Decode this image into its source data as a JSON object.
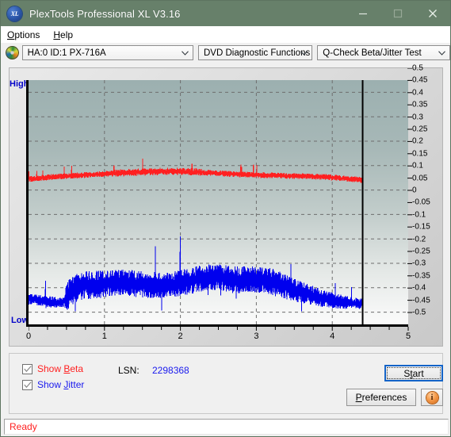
{
  "window": {
    "title": "PlexTools Professional XL V3.16",
    "app_icon": "xl-badge-icon",
    "badge_text": "XL",
    "minimize": "minimize-icon",
    "maximize": "maximize-icon",
    "close": "close-icon",
    "titlebar_color": "#67806a"
  },
  "menu": {
    "items": [
      {
        "label": "Options",
        "accel": "O"
      },
      {
        "label": "Help",
        "accel": "H"
      }
    ]
  },
  "toolbar": {
    "drive_icon": "cd-disc-icon",
    "drive": {
      "value": "HA:0 ID:1  PX-716A"
    },
    "function": {
      "value": "DVD Diagnostic Functions"
    },
    "test": {
      "value": "Q-Check Beta/Jitter Test"
    }
  },
  "chart_labels": {
    "high": "High",
    "low": "Low"
  },
  "controls": {
    "show_beta": {
      "label_pre": "Show ",
      "accel": "B",
      "label_post": "eta",
      "checked": true,
      "color": "#ff2020"
    },
    "show_jitter": {
      "label_pre": "Show ",
      "accel": "J",
      "label_post": "itter",
      "checked": true,
      "color": "#1a1aee"
    },
    "lsn_label": "LSN:",
    "lsn_value": "2298368",
    "start": {
      "label_pre": "S",
      "accel": "t",
      "label_post": "art",
      "focused": true
    },
    "preferences": {
      "label_pre": "P",
      "accel": "",
      "label_post": "references"
    },
    "info_icon": "info-icon",
    "info_glyph": "i"
  },
  "status": {
    "text": "Ready",
    "color": "#ff2020"
  },
  "chart_data": {
    "type": "line",
    "title": "Q-Check Beta/Jitter Test",
    "xlabel": "",
    "ylabel": "",
    "xlim": [
      0,
      5
    ],
    "ylim": [
      -0.5,
      0.5
    ],
    "grid": true,
    "legend_position": "bottom-left",
    "x_ticks": [
      0,
      1,
      2,
      3,
      4,
      5
    ],
    "x_tick_labels": [
      "0",
      "1",
      "2",
      "3",
      "4",
      "5"
    ],
    "x_minor_ticks_per_major": 4,
    "y_ticks": [
      0.5,
      0.45,
      0.4,
      0.35,
      0.3,
      0.25,
      0.2,
      0.15,
      0.1,
      0.05,
      0,
      -0.05,
      -0.1,
      -0.15,
      -0.2,
      -0.25,
      -0.3,
      -0.35,
      -0.4,
      -0.45,
      -0.5
    ],
    "y_tick_labels": [
      "0.5",
      "0.45",
      "0.4",
      "0.35",
      "0.3",
      "0.25",
      "0.2",
      "0.15",
      "0.1",
      "0.05",
      "0",
      "-0.05",
      "-0.1",
      "-0.15",
      "-0.2",
      "-0.25",
      "-0.3",
      "-0.35",
      "-0.4",
      "-0.45",
      "-0.5"
    ],
    "gridline_y_values": [
      0.45,
      0.35,
      0.25,
      0.15,
      0.05,
      -0.05,
      -0.15,
      -0.25,
      -0.35,
      -0.45
    ],
    "cursor_line_x": 4.4,
    "data_end_x": 4.4,
    "plot_bg_gradient": [
      "#9cb0b0",
      "#fbfbfb"
    ],
    "series": [
      {
        "name": "Beta",
        "color": "#ff2020",
        "x": [
          0.0,
          0.11,
          0.22,
          0.33,
          0.44,
          0.55,
          0.66,
          0.77,
          0.88,
          0.99,
          1.1,
          1.21,
          1.32,
          1.43,
          1.54,
          1.65,
          1.76,
          1.87,
          1.98,
          2.09,
          2.2,
          2.31,
          2.42,
          2.53,
          2.64,
          2.75,
          2.86,
          2.97,
          3.08,
          3.19,
          3.3,
          3.41,
          3.52,
          3.63,
          3.74,
          3.85,
          3.96,
          4.07,
          4.18,
          4.29,
          4.4
        ],
        "values": [
          0.095,
          0.098,
          0.101,
          0.104,
          0.106,
          0.108,
          0.11,
          0.112,
          0.114,
          0.116,
          0.118,
          0.12,
          0.122,
          0.123,
          0.124,
          0.125,
          0.126,
          0.126,
          0.126,
          0.125,
          0.124,
          0.122,
          0.12,
          0.118,
          0.116,
          0.114,
          0.113,
          0.112,
          0.111,
          0.11,
          0.109,
          0.108,
          0.107,
          0.106,
          0.105,
          0.104,
          0.102,
          0.1,
          0.097,
          0.094,
          0.09
        ],
        "noise_band": 0.012,
        "description": "Beta value, fairly flat between 0.09 and 0.13, peaking near x=1.8 and sloping down toward the end"
      },
      {
        "name": "Jitter",
        "color": "#0000ee",
        "x": [
          0.0,
          0.11,
          0.22,
          0.33,
          0.44,
          0.55,
          0.66,
          0.77,
          0.88,
          0.99,
          1.1,
          1.21,
          1.32,
          1.43,
          1.54,
          1.65,
          1.76,
          1.87,
          1.98,
          2.09,
          2.2,
          2.31,
          2.42,
          2.53,
          2.64,
          2.75,
          2.86,
          2.97,
          3.08,
          3.19,
          3.3,
          3.41,
          3.52,
          3.63,
          3.74,
          3.85,
          3.96,
          4.07,
          4.18,
          4.29,
          4.4
        ],
        "values": [
          -0.395,
          -0.4,
          -0.405,
          -0.41,
          -0.412,
          -0.37,
          -0.345,
          -0.34,
          -0.338,
          -0.335,
          -0.33,
          -0.33,
          -0.332,
          -0.335,
          -0.338,
          -0.34,
          -0.34,
          -0.338,
          -0.332,
          -0.325,
          -0.318,
          -0.312,
          -0.308,
          -0.31,
          -0.315,
          -0.318,
          -0.316,
          -0.314,
          -0.318,
          -0.325,
          -0.335,
          -0.348,
          -0.36,
          -0.372,
          -0.382,
          -0.392,
          -0.4,
          -0.406,
          -0.41,
          -0.414,
          -0.416
        ],
        "noise_band": 0.055,
        "description": "Jitter noise band; low and narrow until x=0.5, widens to a dense band between -0.22 and -0.46, then narrows and settles near -0.42 at the end"
      }
    ]
  }
}
